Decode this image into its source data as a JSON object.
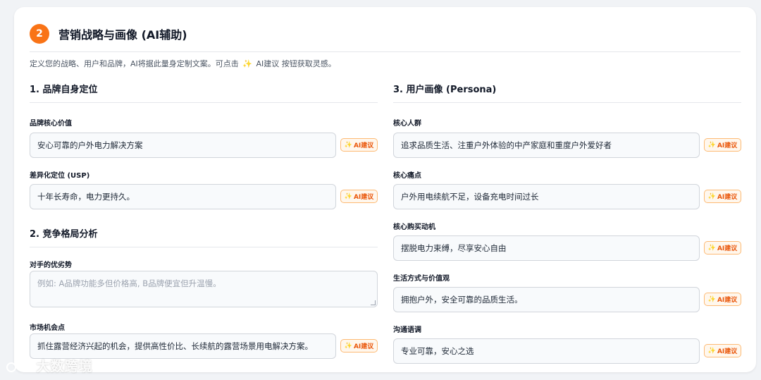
{
  "header": {
    "step": "2",
    "title": "营销战略与画像 (AI辅助)",
    "desc_before": "定义您的战略、用户和品牌，AI将据此量身定制文案。可点击",
    "desc_spark": "✨",
    "desc_after": "AI建议 按钮获取灵感。"
  },
  "ai_button_label": "AI建议",
  "left": {
    "sec1_title": "1. 品牌自身定位",
    "core_value_label": "品牌核心价值",
    "core_value": "安心可靠的户外电力解决方案",
    "usp_label": "差异化定位 (USP)",
    "usp": "十年长寿命，电力更持久。",
    "sec2_title": "2. 竞争格局分析",
    "competitor_label": "对手的优劣势",
    "competitor_placeholder": "例如: A品牌功能多但价格高, B品牌便宜但升温慢。",
    "opportunity_label": "市场机会点",
    "opportunity": "抓住露营经济兴起的机会，提供高性价比、长续航的露营场景用电解决方案。"
  },
  "right": {
    "sec3_title": "3. 用户画像 (Persona)",
    "audience_label": "核心人群",
    "audience": "追求品质生活、注重户外体验的中产家庭和重度户外爱好者",
    "pain_label": "核心痛点",
    "pain": "户外用电续航不足，设备充电时间过长",
    "motive_label": "核心购买动机",
    "motive": "摆脱电力束缚，尽享安心自由",
    "lifestyle_label": "生活方式与价值观",
    "lifestyle": "拥抱户外，安全可靠的品质生活。",
    "tone_label": "沟通语调",
    "tone": "专业可靠，安心之选"
  },
  "watermark": "大数跨境"
}
